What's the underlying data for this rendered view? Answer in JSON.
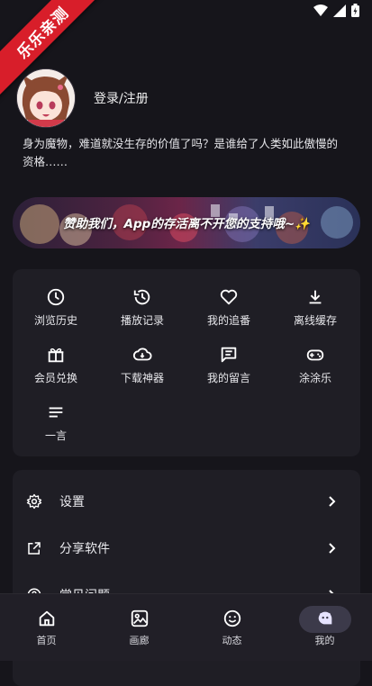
{
  "badge": "乐乐亲测",
  "profile": {
    "login_label": "登录/注册",
    "bio": "身为魔物，难道就没生存的价值了吗？是谁给了人类如此傲慢的资格……"
  },
  "banner": {
    "text": "赞助我们，App的存活离不开您的支持哦~✨"
  },
  "grid": [
    {
      "label": "浏览历史",
      "icon": "clock-icon"
    },
    {
      "label": "播放记录",
      "icon": "history-icon"
    },
    {
      "label": "我的追番",
      "icon": "heart-icon"
    },
    {
      "label": "离线缓存",
      "icon": "download-icon"
    },
    {
      "label": "会员兑换",
      "icon": "gift-icon"
    },
    {
      "label": "下载神器",
      "icon": "cloud-download-icon"
    },
    {
      "label": "我的留言",
      "icon": "message-icon"
    },
    {
      "label": "涂涂乐",
      "icon": "gamepad-icon"
    },
    {
      "label": "一言",
      "icon": "lines-icon"
    }
  ],
  "menu": [
    {
      "label": "设置",
      "icon": "gear-icon"
    },
    {
      "label": "分享软件",
      "icon": "share-icon"
    },
    {
      "label": "常见问题",
      "icon": "help-icon"
    }
  ],
  "nav": [
    {
      "label": "首页",
      "icon": "home-icon"
    },
    {
      "label": "画廊",
      "icon": "gallery-icon"
    },
    {
      "label": "动态",
      "icon": "smile-icon"
    },
    {
      "label": "我的",
      "icon": "profile-icon"
    }
  ],
  "colors": {
    "background": "#16151b",
    "card": "#1f1e25",
    "ribbon": "#d81e2a",
    "nav_active_pill": "#3c3a4a"
  }
}
